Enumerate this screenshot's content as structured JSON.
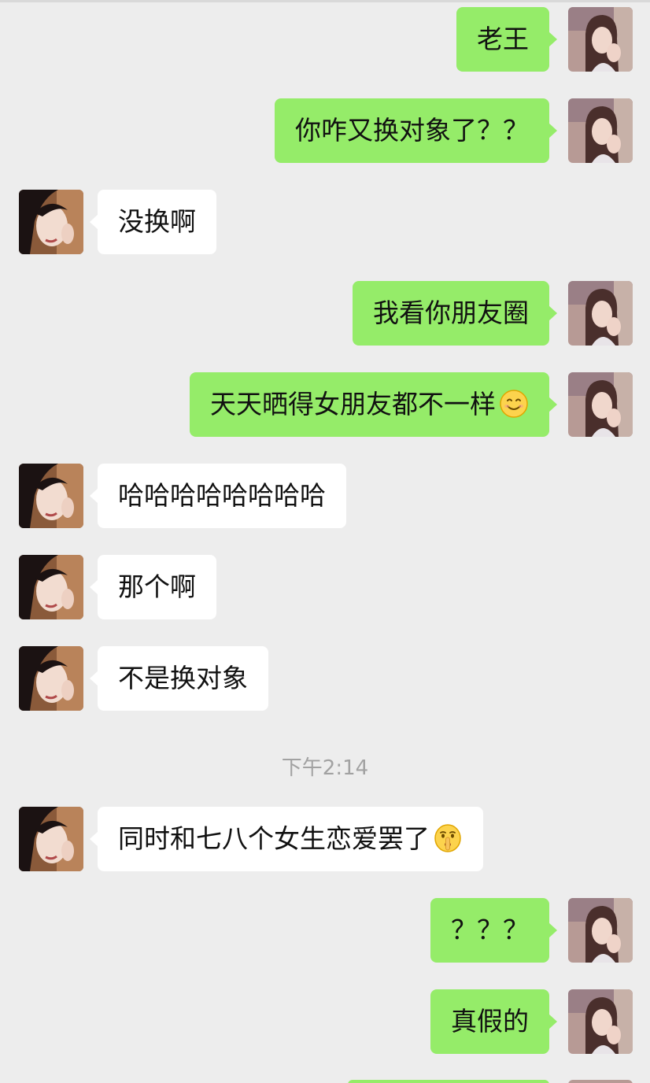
{
  "chat": {
    "colors": {
      "background": "#ededed",
      "outgoing_bubble": "#95ec69",
      "incoming_bubble": "#ffffff",
      "timestamp_text": "#a2a2a2"
    },
    "timestamp": "下午2:14",
    "messages": [
      {
        "side": "out",
        "text": "老王",
        "sender": "me"
      },
      {
        "side": "out",
        "text": "你咋又换对象了？？",
        "sender": "me"
      },
      {
        "side": "in",
        "text": "没换啊",
        "sender": "friend"
      },
      {
        "side": "out",
        "text": "我看你朋友圈",
        "sender": "me"
      },
      {
        "side": "out",
        "text": "天天晒得女朋友都不一样",
        "emoji": "smiling-face-icon",
        "sender": "me"
      },
      {
        "side": "in",
        "text": "哈哈哈哈哈哈哈哈",
        "sender": "friend"
      },
      {
        "side": "in",
        "text": "那个啊",
        "sender": "friend"
      },
      {
        "side": "in",
        "text": "不是换对象",
        "sender": "friend"
      },
      {
        "side": "in",
        "text": "同时和七八个女生恋爱罢了",
        "emoji": "shushing-face-icon",
        "sender": "friend"
      },
      {
        "side": "out",
        "text": "？？？",
        "sender": "me"
      },
      {
        "side": "out",
        "text": "真假的",
        "sender": "me"
      }
    ]
  }
}
